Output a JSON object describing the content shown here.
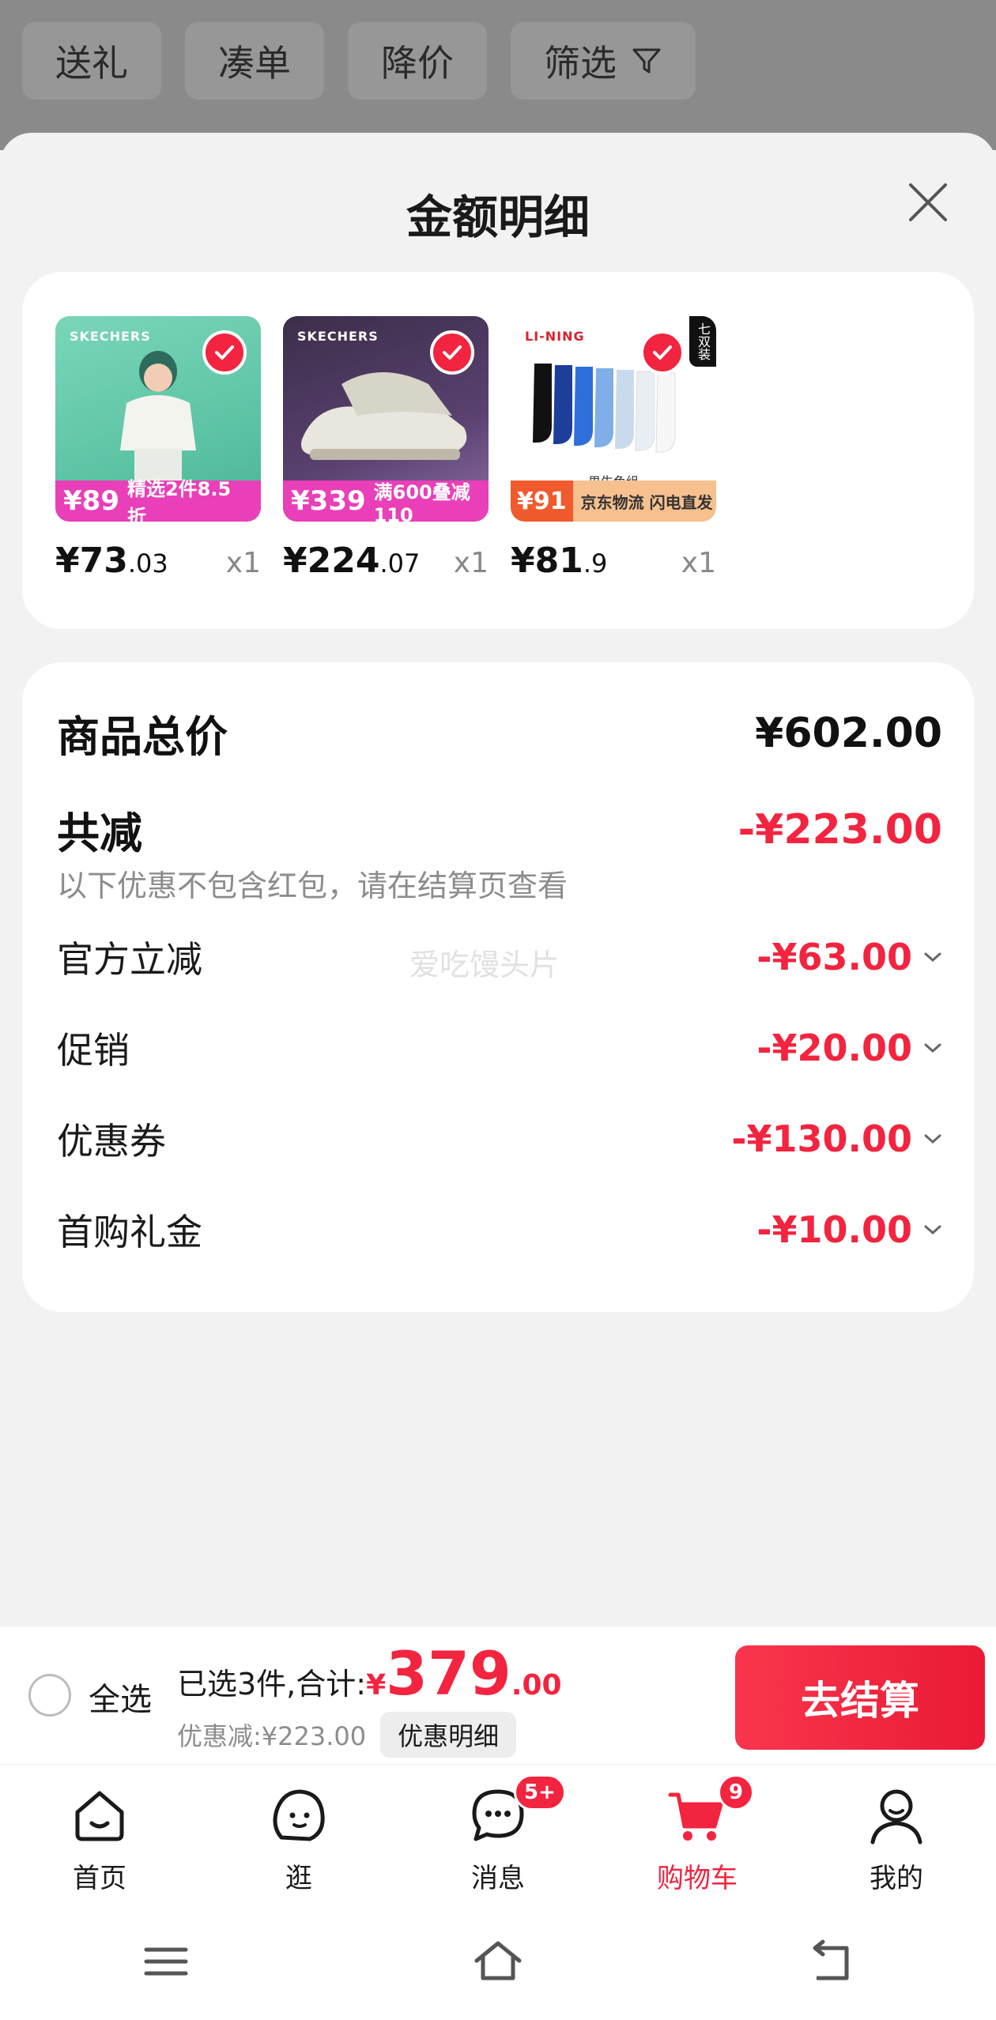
{
  "filter_chips": [
    {
      "label": "送礼"
    },
    {
      "label": "凑单"
    },
    {
      "label": "降价"
    },
    {
      "label": "筛选",
      "icon": "filter-icon"
    }
  ],
  "sheet": {
    "title": "金额明细",
    "close_icon": "close-icon"
  },
  "products": [
    {
      "price_int": "¥73",
      "price_dec": ".03",
      "qty": "x1",
      "brand": "SKECHERS",
      "badge_price": "¥89",
      "promo": "精选2件8.5折"
    },
    {
      "price_int": "¥224",
      "price_dec": ".07",
      "qty": "x1",
      "brand": "SKECHERS",
      "badge_price": "¥339",
      "promo": "满600叠减110"
    },
    {
      "price_int": "¥81",
      "price_dec": ".9",
      "qty": "x1",
      "brand": "LI-NING",
      "badge_price": "¥91",
      "promo": "京东物流 闪电直发",
      "caption": "男生色组",
      "corner_tag": "七双装"
    }
  ],
  "summary": {
    "total_label": "商品总价",
    "total_value": "¥602.00",
    "reduce_label": "共减",
    "reduce_value": "-¥223.00",
    "note": "以下优惠不包含红包，请在结算页查看",
    "watermark": "爱吃馒头片",
    "items": [
      {
        "label": "官方立减",
        "value": "-¥63.00"
      },
      {
        "label": "促销",
        "value": "-¥20.00"
      },
      {
        "label": "优惠券",
        "value": "-¥130.00"
      },
      {
        "label": "首购礼金",
        "value": "-¥10.00"
      }
    ]
  },
  "checkout": {
    "select_all": "全选",
    "selected_text": "已选3件,合计:",
    "total_yen": "¥",
    "total_int": "379",
    "total_dec": ".00",
    "discount_text": "优惠减:¥223.00",
    "detail_button": "优惠明细",
    "checkout_button": "去结算"
  },
  "tabbar": [
    {
      "label": "首页",
      "icon": "home-icon"
    },
    {
      "label": "逛",
      "icon": "browse-face-icon"
    },
    {
      "label": "消息",
      "icon": "message-icon",
      "badge": "5+"
    },
    {
      "label": "购物车",
      "icon": "cart-icon",
      "badge": "9",
      "active": true
    },
    {
      "label": "我的",
      "icon": "profile-icon"
    }
  ],
  "colors": {
    "accent_red": "#f2243f",
    "dim_overlay": "#8a8a8a"
  }
}
